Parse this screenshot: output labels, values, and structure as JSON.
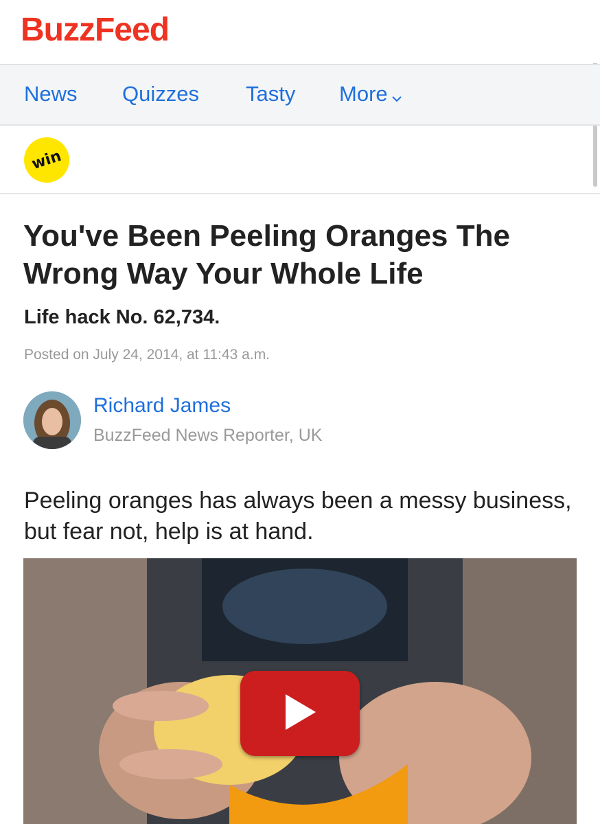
{
  "brand": {
    "logo": "BuzzFeed",
    "color": "#ee3322"
  },
  "nav": {
    "items": [
      {
        "label": "News"
      },
      {
        "label": "Quizzes"
      },
      {
        "label": "Tasty"
      },
      {
        "label": "More"
      }
    ],
    "more_icon": "chevron-down-icon"
  },
  "badge": {
    "label": "win",
    "color": "#ffe600"
  },
  "article": {
    "title": "You've Been Peeling Oranges The Wrong Way Your Whole Life",
    "subtitle": "Life hack No. 62,734.",
    "posted": "Posted on July 24, 2014, at 11:43 a.m.",
    "author": {
      "name": "Richard James",
      "role": "BuzzFeed News Reporter, UK"
    },
    "lede": "Peeling oranges has always been a messy business, but fear not, help is at hand."
  },
  "video": {
    "play_icon": "play-icon",
    "button_color": "#cc1e1e"
  },
  "colors": {
    "link": "#1e6fdd",
    "muted": "#999999",
    "text": "#222222"
  }
}
